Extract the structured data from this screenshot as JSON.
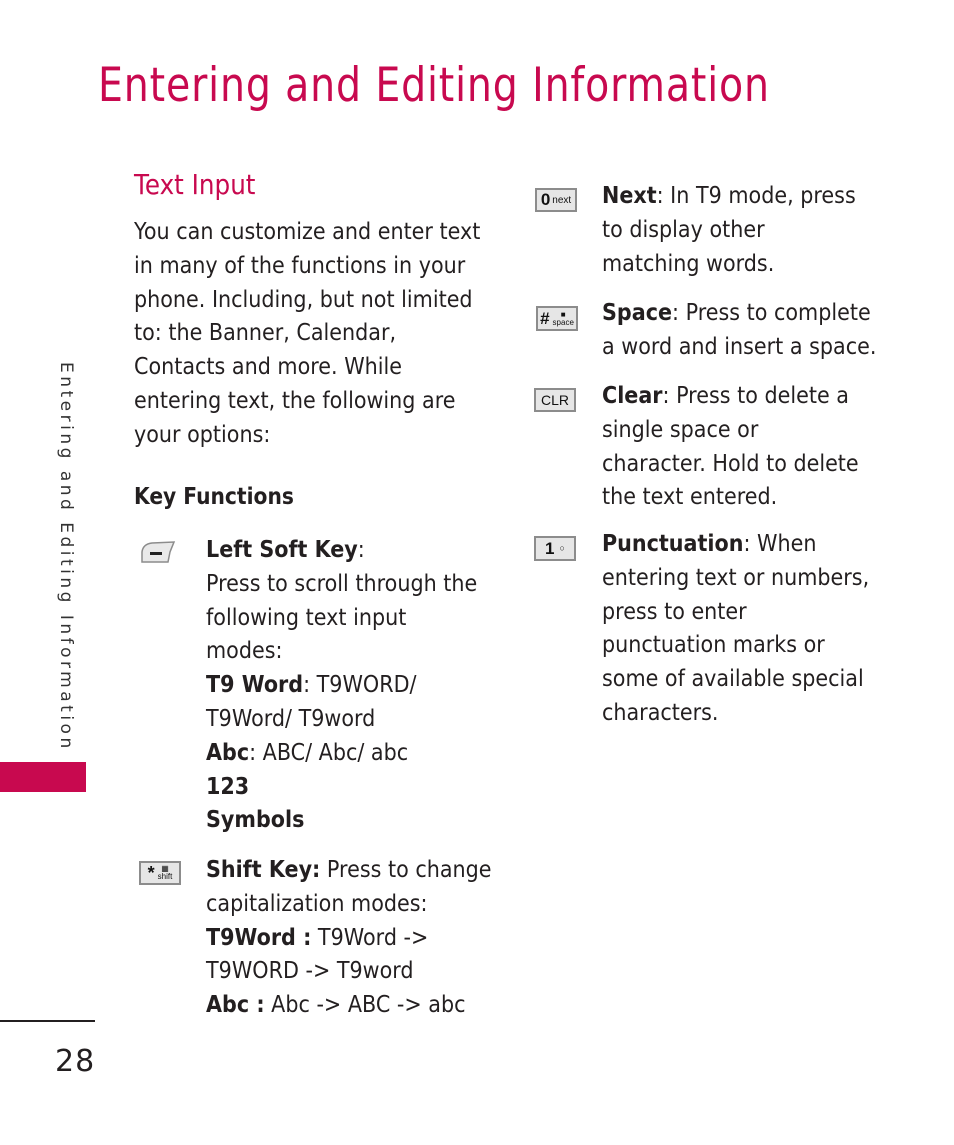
{
  "page": {
    "title": "Entering and Editing Information",
    "side_tab_label": "Entering and Editing Information",
    "page_number": "28",
    "accent_color": "#c8094f"
  },
  "section": {
    "title": "Text Input",
    "intro_lines": [
      "You can customize and enter text",
      "in many of the functions in your",
      "phone. Including, but not limited",
      "to: the Banner, Calendar,",
      "Contacts and more. While",
      "entering text, the following are",
      "your options:"
    ],
    "key_functions_heading": "Key Functions"
  },
  "left_keys": [
    {
      "icon": "left-soft-key-icon",
      "name": "Left Soft Key",
      "after_name": ":",
      "lines": [
        {
          "bold": "",
          "text": "Press to scroll through the"
        },
        {
          "bold": "",
          "text": "following text input"
        },
        {
          "bold": "",
          "text": "modes:"
        },
        {
          "bold": "T9 Word",
          "text": ": T9WORD/"
        },
        {
          "bold": "",
          "text": "T9Word/ T9word"
        },
        {
          "bold": "Abc",
          "text": ": ABC/ Abc/ abc"
        },
        {
          "bold": "123",
          "text": ""
        },
        {
          "bold": "Symbols",
          "text": ""
        }
      ]
    },
    {
      "icon": "shift-key-icon",
      "icon_symbol": "*",
      "icon_sub": "shift",
      "name": "Shift Key:",
      "first_text": " Press to change",
      "lines": [
        {
          "bold": "",
          "text": "capitalization modes:"
        },
        {
          "bold": "T9Word :",
          "text": " T9Word ->"
        },
        {
          "bold": "",
          "text": "T9WORD -> T9word"
        },
        {
          "bold": "Abc :",
          "text": " Abc -> ABC -> abc"
        }
      ]
    }
  ],
  "right_keys": [
    {
      "icon": "next-key-icon",
      "key_main": "0",
      "key_sub": "next",
      "name": "Next",
      "first_text": ": In T9 mode, press",
      "lines": [
        "to display other",
        "matching words."
      ]
    },
    {
      "icon": "space-key-icon",
      "key_main": "#",
      "key_sub": "space",
      "name": "Space",
      "first_text": ": Press to complete",
      "lines": [
        "a word and insert a space."
      ]
    },
    {
      "icon": "clear-key-icon",
      "key_main": "CLR",
      "name": "Clear",
      "first_text": ": Press to delete a",
      "lines": [
        "single space or",
        "character. Hold to delete",
        "the text entered."
      ]
    },
    {
      "icon": "punctuation-key-icon",
      "key_main": "1",
      "name": "Punctuation",
      "first_text": ": When",
      "lines": [
        "entering text or numbers,",
        "press to enter",
        "punctuation marks or",
        "some of available special",
        "characters."
      ]
    }
  ]
}
